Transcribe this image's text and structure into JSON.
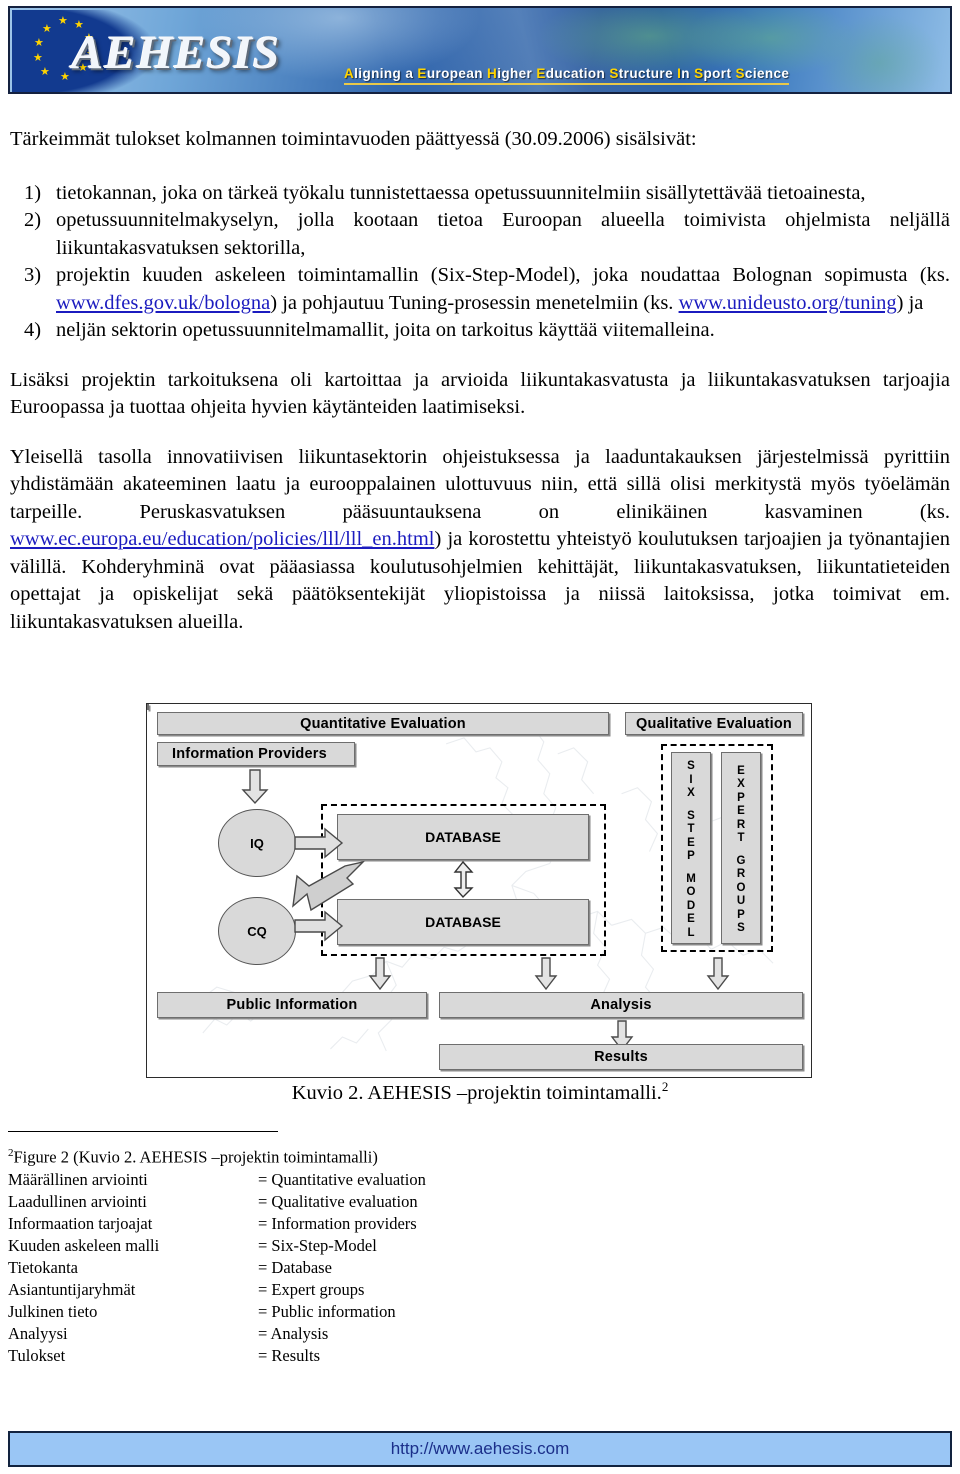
{
  "banner": {
    "logo_text": "AEHESIS",
    "tagline": "Aligning a European Higher Education Structure In Sport Science"
  },
  "content": {
    "intro": "Tärkeimmät tulokset kolmannen toimintavuoden päättyessä (30.09.2006) sisälsivät:",
    "items": [
      {
        "num": "1)",
        "text": "tietokannan, joka on tärkeä työkalu tunnistettaessa opetussuunnitelmiin sisällytettävää tietoainesta,"
      },
      {
        "num": "2)",
        "text": "opetussuunnitelmakyselyn, jolla kootaan tietoa Euroopan alueella toimivista ohjelmista neljällä liikuntakasvatuksen sektorilla,"
      },
      {
        "num": "3)",
        "text_a": "projektin kuuden askeleen toimintamallin (Six-Step-Model), joka noudattaa Bolognan sopimusta (ks. ",
        "link_a": "www.dfes.gov.uk/bologna",
        "text_b": ") ja pohjautuu Tuning-prosessin menetelmiin (ks. ",
        "link_b": "www.unideusto.org/tuning",
        "text_c": ") ja"
      },
      {
        "num": "4)",
        "text": "neljän sektorin opetussuunnitelmamallit, joita on tarkoitus käyttää viitemalleina."
      }
    ],
    "para2": "Lisäksi projektin tarkoituksena oli kartoittaa ja arvioida liikuntakasvatusta ja liikuntakasvatuksen tarjoajia Euroopassa ja tuottaa ohjeita hyvien käytänteiden laatimiseksi.",
    "para3_a": "Yleisellä tasolla innovatiivisen liikuntasektorin ohjeistuksessa ja laaduntakauksen järjestelmissä pyrittiin yhdistämään akateeminen laatu ja eurooppalainen ulottuvuus niin, että sillä olisi merkitystä myös työelämän tarpeille. Peruskasvatuksen pääsuuntauksena on elinikäinen kasvaminen (ks. ",
    "para3_link": "www.ec.europa.eu/education/policies/lll/lll_en.html",
    "para3_b": ") ja korostettu yhteistyö koulutuksen tarjoajien ja työnantajien välillä. Kohderyhminä ovat pääasiassa koulutusohjelmien kehittäjät, liikuntakasvatuksen, liikuntatieteiden opettajat ja opiskelijat sekä päätöksentekijät yliopistoissa ja niissä laitoksissa, jotka toimivat em. liikuntakasvatuksen alueilla."
  },
  "diagram": {
    "quantitative_title": "Quantitative Evaluation",
    "qualitative_title": "Qualitative Evaluation",
    "information_providers": "Information Providers",
    "iq": "IQ",
    "cq": "CQ",
    "database_top": "DATABASE",
    "database_bottom": "DATABASE",
    "six_step_model": "SIX STEP MODEL",
    "six_step_model_letters": [
      "S",
      "I",
      "X",
      "",
      "S",
      "T",
      "E",
      "P",
      "",
      "M",
      "O",
      "D",
      "E",
      "L"
    ],
    "expert_groups": "EXPERT GROUPS",
    "expert_groups_letters": [
      "E",
      "X",
      "P",
      "E",
      "R",
      "T",
      "",
      "G",
      "R",
      "O",
      "U",
      "P",
      "S"
    ],
    "public_information": "Public Information",
    "analysis": "Analysis",
    "results": "Results",
    "box_fill": "#d9d9d9",
    "border_color": "#6e6e6e"
  },
  "caption": {
    "text": "Kuvio 2. AEHESIS –projektin toimintamalli.",
    "footnote_marker": "2"
  },
  "footnotes": {
    "marker": "2",
    "first_line": "Figure 2 (Kuvio 2. AEHESIS –projektin toimintamalli)",
    "glossary": [
      {
        "fi": "Määrällinen arviointi",
        "en": "= Quantitative evaluation"
      },
      {
        "fi": "Laadullinen arviointi",
        "en": "= Qualitative evaluation"
      },
      {
        "fi": "Informaation tarjoajat",
        "en": "= Information providers"
      },
      {
        "fi": "Kuuden askeleen malli",
        "en": "= Six-Step-Model"
      },
      {
        "fi": "Tietokanta",
        "en": "= Database"
      },
      {
        "fi": "Asiantuntijaryhmät",
        "en": "= Expert groups"
      },
      {
        "fi": "Julkinen tieto",
        "en": "= Public information"
      },
      {
        "fi": "Analyysi",
        "en": "= Analysis"
      },
      {
        "fi": "Tulokset",
        "en": "= Results"
      }
    ]
  },
  "footer": {
    "url": "http://www.aehesis.com",
    "background": "#9ac6f5"
  }
}
